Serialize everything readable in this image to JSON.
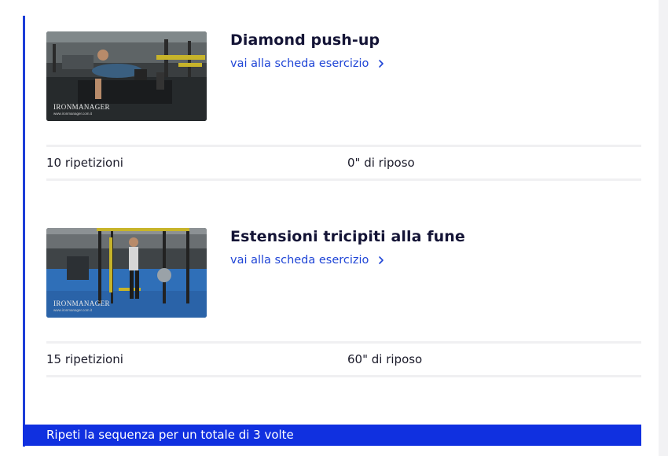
{
  "exercises": [
    {
      "title": "Diamond push-up",
      "link_label": "vai alla scheda esercizio",
      "repetitions": "10 ripetizioni",
      "rest": "0\" di riposo",
      "thumbnail": {
        "brand": "IronManager",
        "url_text": "www.ironmanager.com.it"
      }
    },
    {
      "title": "Estensioni tricipiti alla fune",
      "link_label": "vai alla scheda esercizio",
      "repetitions": "15 ripetizioni",
      "rest": "60\" di riposo",
      "thumbnail": {
        "brand": "IronManager",
        "url_text": "www.ironmanager.com.it"
      }
    }
  ],
  "footer": {
    "text": "Ripeti la sequenza per un totale di 3 volte"
  },
  "colors": {
    "accent": "#1c3dd8",
    "footer_bg": "#1030e0",
    "title": "#141436",
    "link": "#1f45d6"
  },
  "icons": {
    "link_arrow": "chevron-right-icon"
  }
}
